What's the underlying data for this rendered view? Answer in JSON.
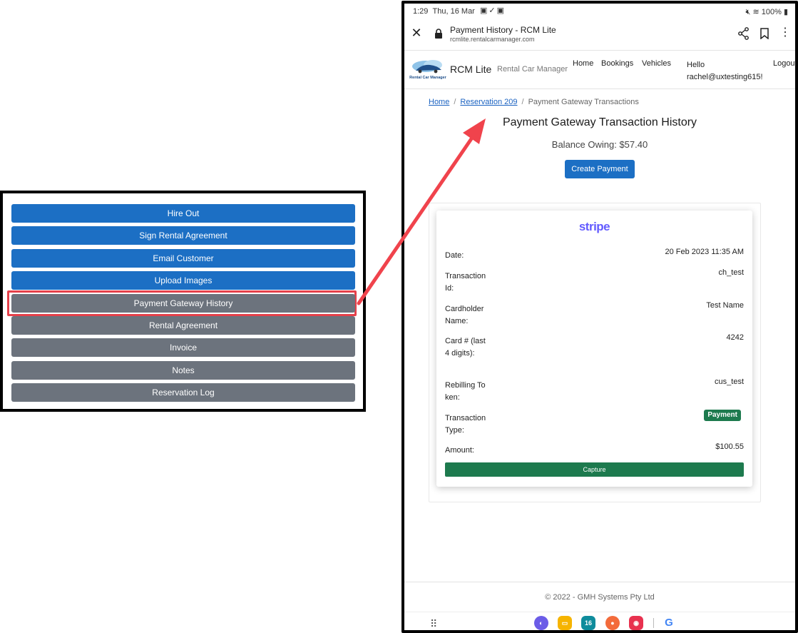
{
  "left_panel": {
    "buttons": [
      {
        "label": "Hire Out",
        "style": "primary"
      },
      {
        "label": "Sign Rental Agreement",
        "style": "primary"
      },
      {
        "label": "Email Customer",
        "style": "primary"
      },
      {
        "label": "Upload Images",
        "style": "primary"
      },
      {
        "label": "Payment Gateway History",
        "style": "secondary",
        "highlighted": true
      },
      {
        "label": "Rental Agreement",
        "style": "secondary"
      },
      {
        "label": "Invoice",
        "style": "secondary"
      },
      {
        "label": "Notes",
        "style": "secondary"
      },
      {
        "label": "Reservation Log",
        "style": "secondary"
      }
    ]
  },
  "status_bar": {
    "time": "1:29",
    "date": "Thu, 16 Mar",
    "battery": "100%"
  },
  "browser": {
    "title": "Payment History - RCM Lite",
    "url": "rcmlite.rentalcarmanager.com"
  },
  "site": {
    "logo_text": "Rental Car Manager",
    "brand": "RCM Lite",
    "brand_sub": "Rental Car Manager",
    "nav": {
      "home": "Home",
      "bookings": "Bookings",
      "vehicles": "Vehicles",
      "hello_line1": "Hello",
      "hello_line2": "rachel@uxtesting615!",
      "logout": "Logout"
    }
  },
  "breadcrumb": {
    "home": "Home",
    "reservation": "Reservation 209",
    "current": "Payment Gateway Transactions",
    "separator": "/"
  },
  "page": {
    "title": "Payment Gateway Transaction History",
    "balance": "Balance Owing: $57.40",
    "create_payment_label": "Create Payment"
  },
  "transaction": {
    "gateway_logo": "stripe",
    "rows": [
      {
        "label": "Date:",
        "value": "20 Feb 2023 11:35 AM"
      },
      {
        "label": "Transaction Id:",
        "value": "ch_test"
      },
      {
        "label": "Cardholder Name:",
        "value": "Test Name"
      },
      {
        "label": "Card # (last 4 digits):",
        "value": "4242"
      },
      {
        "label": "Rebilling Token:",
        "value": "cus_test"
      },
      {
        "label": "Transaction Type:",
        "value": "Payment"
      },
      {
        "label": "Amount:",
        "value": "$100.55"
      }
    ],
    "capture_label": "Capture"
  },
  "footer": {
    "text": "© 2022 - GMH Systems Pty Ltd"
  },
  "dock": {
    "calendar_day": "16"
  },
  "colors": {
    "primary_button": "#1c6fc4",
    "secondary_button": "#6c737d",
    "highlight": "#e5404a",
    "arrow": "#f0434c",
    "success": "#1d7a4e",
    "stripe": "#635bff",
    "link": "#1a62c1"
  }
}
